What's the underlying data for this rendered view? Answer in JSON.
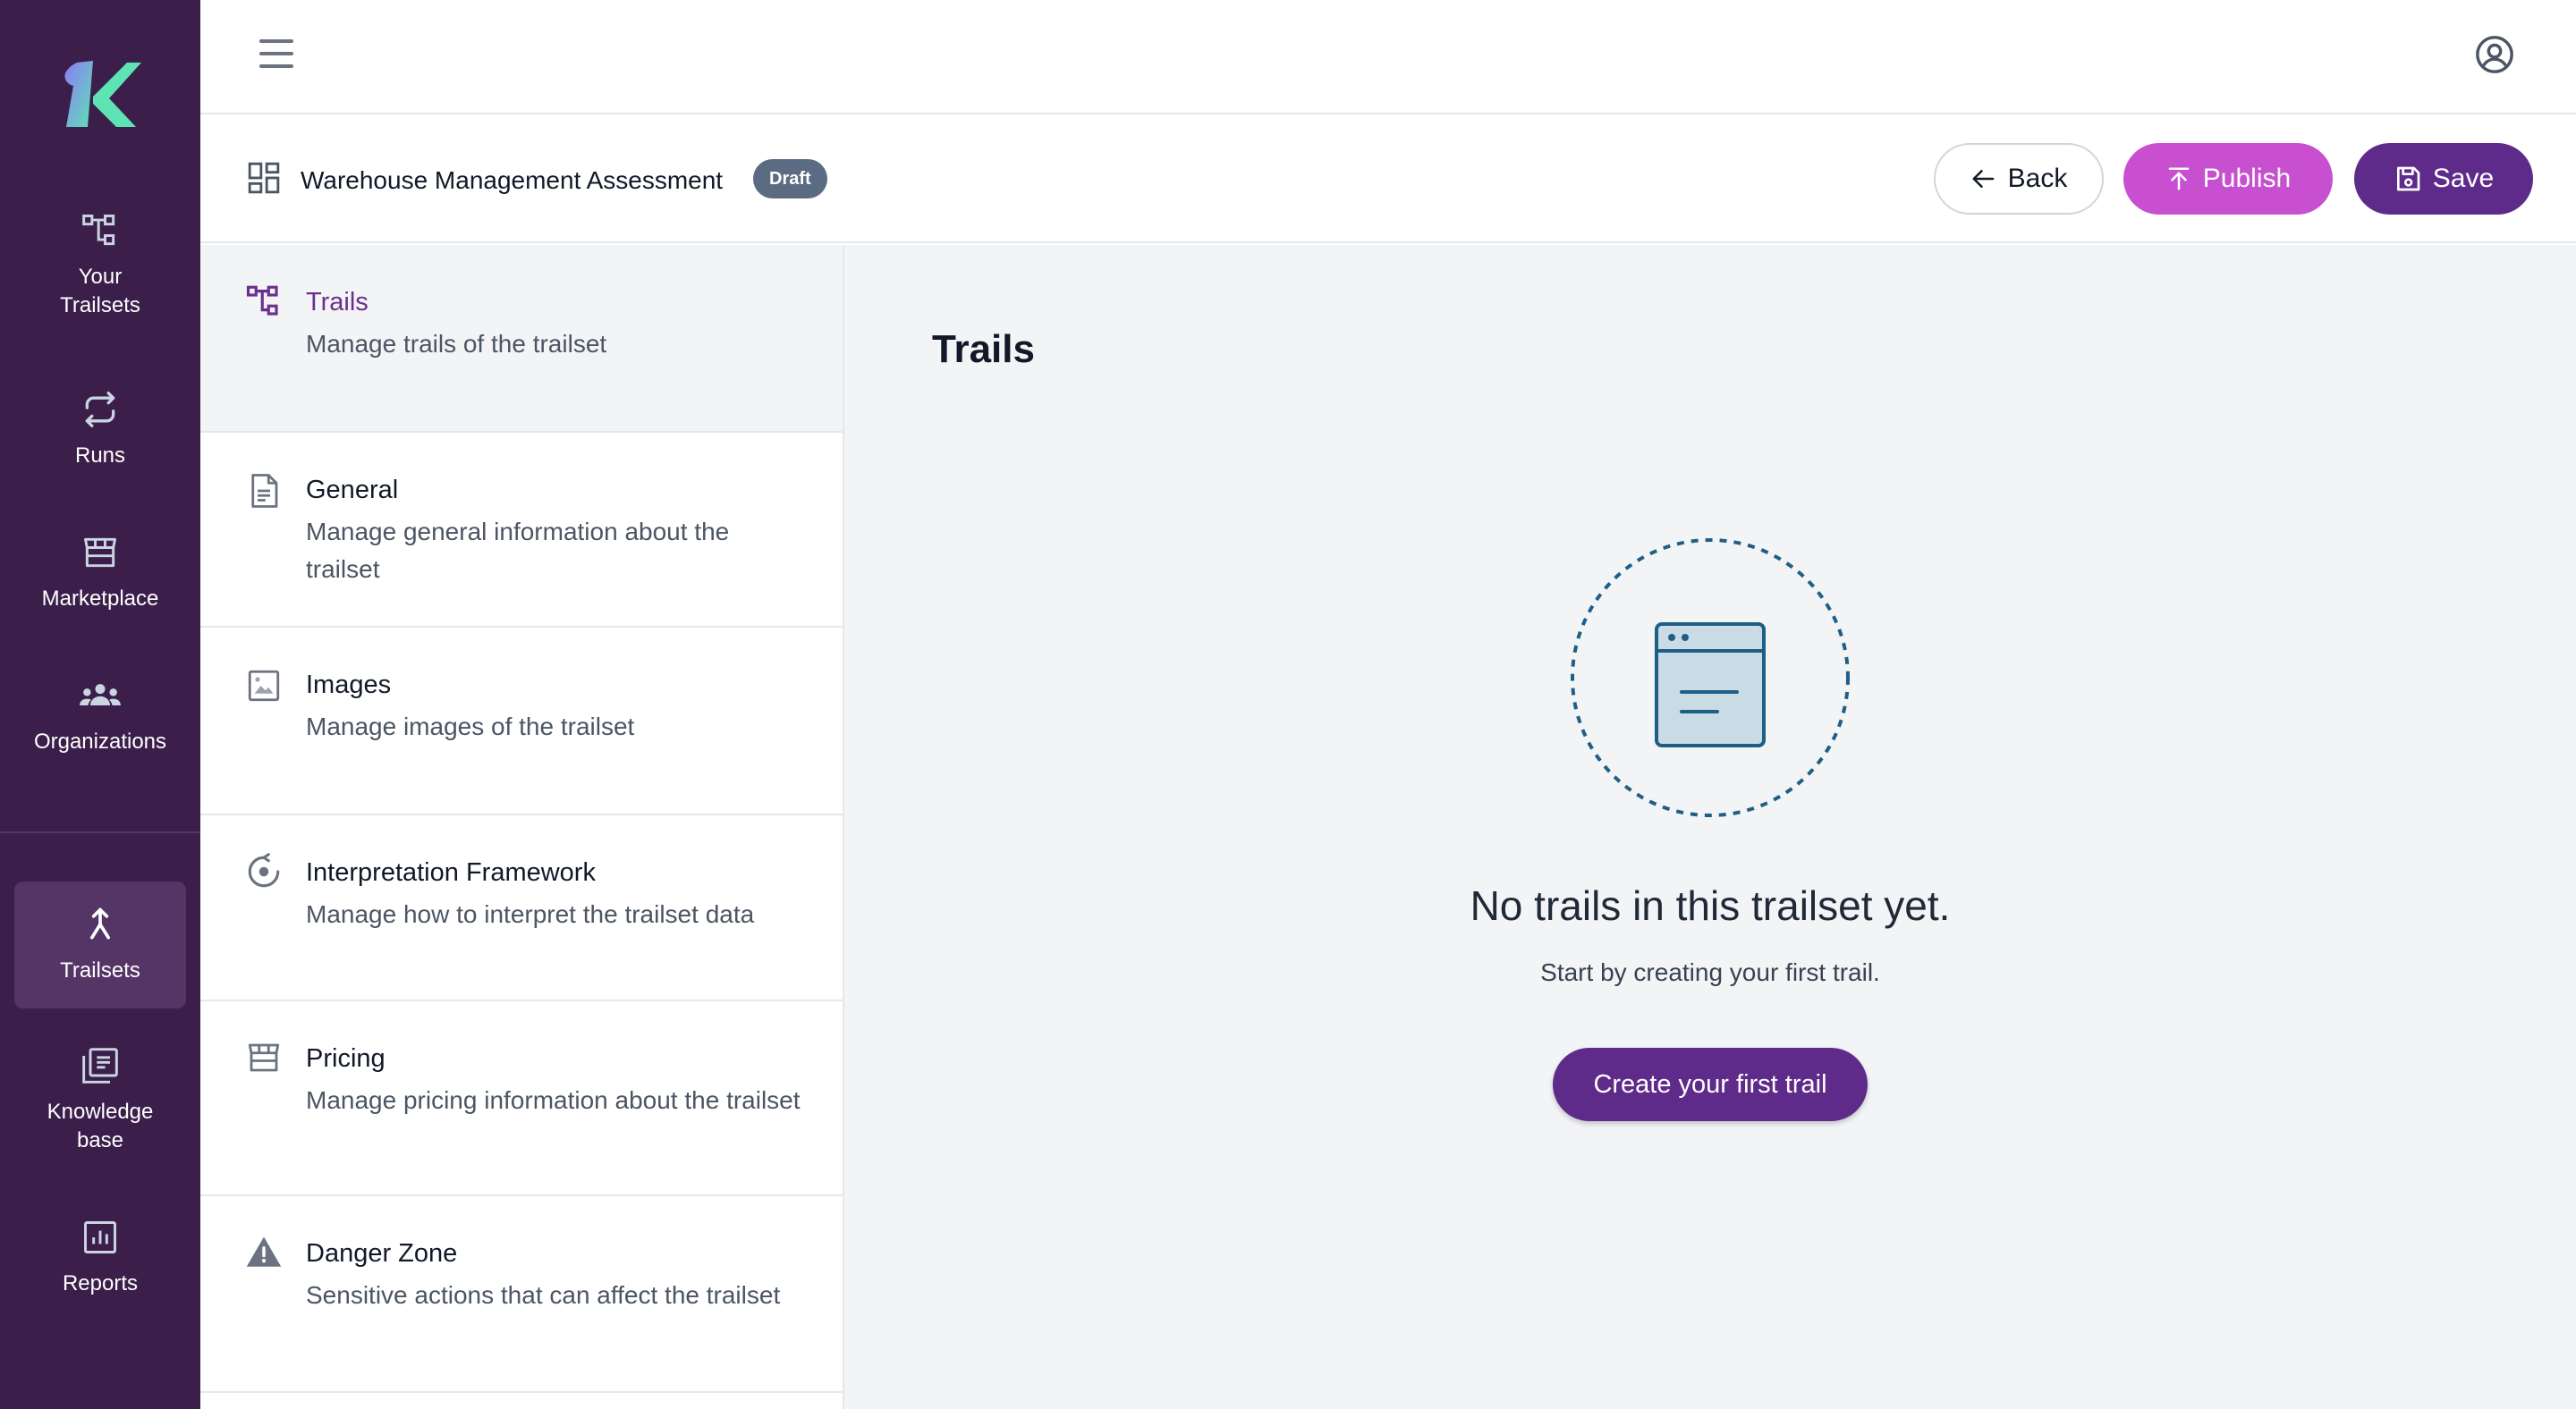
{
  "rail": {
    "items": [
      {
        "label": "Your\nTrailsets",
        "icon": "hierarchy-icon"
      },
      {
        "label": "Runs",
        "icon": "repeat-icon"
      },
      {
        "label": "Marketplace",
        "icon": "store-icon"
      },
      {
        "label": "Organizations",
        "icon": "group-icon"
      },
      {
        "label": "Trailsets",
        "icon": "merge-arrow-icon"
      },
      {
        "label": "Knowledge\nbase",
        "icon": "library-icon"
      },
      {
        "label": "Reports",
        "icon": "report-icon"
      }
    ]
  },
  "titlebar": {
    "title": "Warehouse Management Assessment",
    "badge": "Draft",
    "back_label": "Back",
    "publish_label": "Publish",
    "save_label": "Save"
  },
  "settings": {
    "items": [
      {
        "name": "Trails",
        "desc": "Manage trails of the trailset",
        "icon": "hierarchy-icon"
      },
      {
        "name": "General",
        "desc": "Manage general information about the trailset",
        "icon": "document-icon"
      },
      {
        "name": "Images",
        "desc": "Manage images of the trailset",
        "icon": "image-icon"
      },
      {
        "name": "Interpretation Framework",
        "desc": "Manage how to interpret the trailset data",
        "icon": "interpret-icon"
      },
      {
        "name": "Pricing",
        "desc": "Manage pricing information about the trailset",
        "icon": "store-icon"
      },
      {
        "name": "Danger Zone",
        "desc": "Sensitive actions that can affect the trailset",
        "icon": "warning-icon"
      }
    ]
  },
  "main": {
    "title": "Trails",
    "empty_title": "No trails in this trailset yet.",
    "empty_subtitle": "Start by creating your first trail.",
    "create_label": "Create your first trail"
  },
  "colors": {
    "rail_bg": "#3b1f4a",
    "accent": "#5f2b8a",
    "publish": "#c84fd0",
    "badge": "#5b6b82"
  }
}
